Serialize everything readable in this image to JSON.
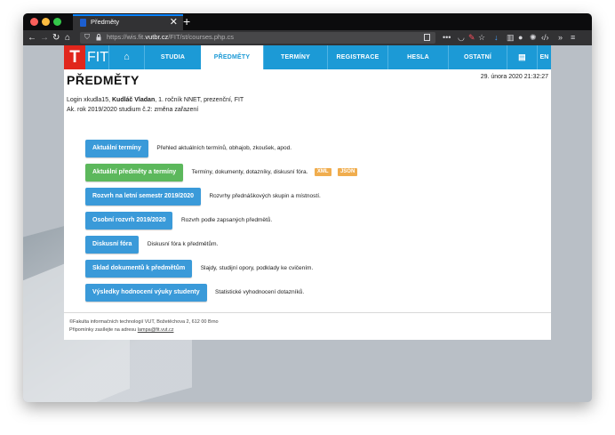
{
  "browser": {
    "tab_title": "Předměty",
    "tab_close": "✕",
    "new_tab": "+",
    "url_prefix": "https://wis.fit.",
    "url_host": "vutbr.cz",
    "url_path": "/FIT/st/courses.php.cs",
    "colors": {
      "close": "#fc605b",
      "minimize": "#fdbc40",
      "maximize": "#34c84a",
      "accent": "#0a84ff"
    }
  },
  "site": {
    "logo_letter": "T",
    "logo_text": "FIT",
    "menu": [
      {
        "label": "⌂",
        "icon": "home-icon"
      },
      {
        "label": "STUDIA"
      },
      {
        "label": "PŘEDMĚTY",
        "active": true
      },
      {
        "label": "TERMÍNY"
      },
      {
        "label": "REGISTRACE"
      },
      {
        "label": "HESLA"
      },
      {
        "label": "OSTATNÍ"
      },
      {
        "label": "▤",
        "icon": "print-icon"
      },
      {
        "label": "EN"
      }
    ]
  },
  "content": {
    "title": "PŘEDMĚTY",
    "datetime": "29. února 2020 21:32:27",
    "login_prefix": "Login xkudla15, ",
    "user_name": "Kudláč Vladan",
    "login_suffix": ", 1. ročník NNET, prezenční, FIT",
    "year_line": "Ak. rok 2019/2020 studium č.2: změna zařazení",
    "actions": [
      {
        "label": "Aktuální termíny",
        "desc": "Přehled aktuálních termínů, obhajob, zkoušek, apod."
      },
      {
        "label": "Aktuální předměty a termíny",
        "desc": "Termíny, dokumenty, dotazníky, diskusní fóra.",
        "green": true,
        "tags": [
          "XML",
          "JSON"
        ]
      },
      {
        "label": "Rozvrh na letní semestr 2019/2020",
        "desc": "Rozvrhy přednáškových skupin a místností."
      },
      {
        "label": "Osobní rozvrh 2019/2020",
        "desc": "Rozvrh podle zapsaných předmětů."
      },
      {
        "label": "Diskusní fóra",
        "desc": "Diskusní fóra k předmětům."
      },
      {
        "label": "Sklad dokumentů k předmětům",
        "desc": "Slajdy, studijní opory, podklady ke cvičením."
      },
      {
        "label": "Výsledky hodnocení výuky studenty",
        "desc": "Statistické vyhodnocení dotazníků."
      }
    ]
  },
  "footer": {
    "line1": "©Fakulta informačních technologií VUT, Božetěchova 2, 612 00 Brno",
    "line2_prefix": "Připomínky zasílejte na adresu ",
    "email": "lampa@fit.vut.cz"
  }
}
